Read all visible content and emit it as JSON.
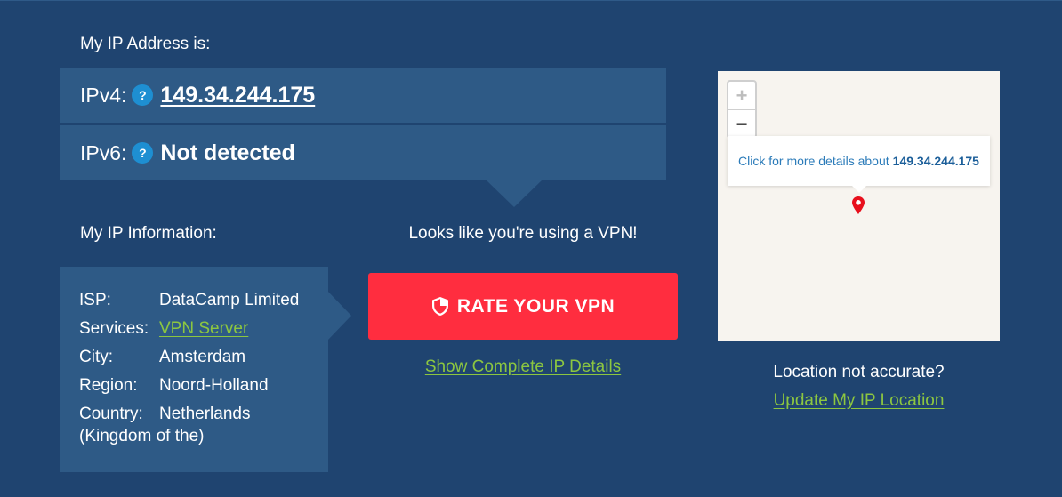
{
  "ip_section": {
    "heading": "My IP Address is:",
    "ipv4_label": "IPv4:",
    "ipv4_value": "149.34.244.175",
    "ipv6_label": "IPv6:",
    "ipv6_value": "Not detected",
    "help_glyph": "?"
  },
  "info_section": {
    "heading": "My IP Information:",
    "isp_key": "ISP:",
    "isp_value": "DataCamp Limited",
    "services_key": "Services:",
    "services_value": "VPN Server",
    "city_key": "City:",
    "city_value": "Amsterdam",
    "region_key": "Region:",
    "region_value": "Noord-Holland",
    "country_key": "Country:",
    "country_value": "Netherlands",
    "country_value_cont": "(Kingdom of the)"
  },
  "vpn": {
    "message": "Looks like you're using a VPN!",
    "rate_button": "RATE YOUR VPN",
    "details_link": "Show Complete IP Details"
  },
  "map": {
    "zoom_in": "+",
    "zoom_out": "−",
    "popup_text": "Click for more details about",
    "popup_ip": "149.34.244.175"
  },
  "location": {
    "question": "Location not accurate?",
    "update_link": "Update My IP Location"
  },
  "colors": {
    "background": "#1f4470",
    "panel": "#2e5a86",
    "accent_red": "#ff2d3f",
    "link_green": "#8cc640",
    "help_blue": "#1e8fd2"
  }
}
